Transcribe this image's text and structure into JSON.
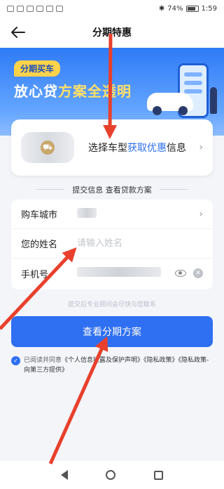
{
  "status_bar": {
    "icons_left": [
      "HD",
      "4G",
      "wifi",
      "app",
      "app",
      "app",
      "app"
    ],
    "battery": "74%",
    "time": "1:59"
  },
  "nav": {
    "back_icon": "arrow-left-icon",
    "title": "分期特惠"
  },
  "banner": {
    "tag": "分期买车",
    "title_part1": "放心贷",
    "title_part2": "方案全透明"
  },
  "vehicle_select": {
    "text_prefix": "选择车型",
    "text_highlight": "获取优惠",
    "text_suffix": "信息"
  },
  "section_title": "提交信息 查看贷款方案",
  "form": {
    "city_label": "购车城市",
    "name_label": "您的姓名",
    "name_placeholder": "请输入姓名",
    "phone_label": "手机号"
  },
  "hint": "提交后专业顾问会尽快与您联系",
  "submit_label": "查看分期方案",
  "agreement": {
    "prefix": "已阅读并同意",
    "link1": "《个人信息披露及保护声明》",
    "link2": "《隐私政策》",
    "link3": "《隐私政策-向第三方提供》"
  },
  "colors": {
    "accent": "#2f6ff1",
    "banner_top": "#2f7bf6",
    "highlight": "#ffe066",
    "arrow": "#e8402c"
  }
}
